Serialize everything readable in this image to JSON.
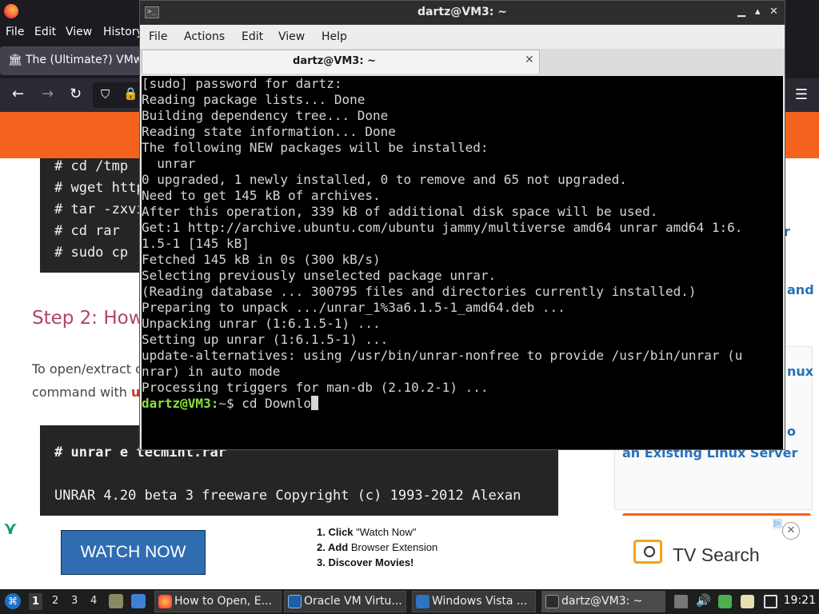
{
  "browser": {
    "menu": [
      "File",
      "Edit",
      "View",
      "History"
    ],
    "tab_title": "The (Ultimate?) VMwa",
    "code_lines": [
      "# cd /tmp",
      "# wget http",
      "# tar -zxvi",
      "# cd rar",
      "# sudo cp"
    ],
    "step_heading": "Step 2: How",
    "para_line1": "To open/extract o",
    "para_line2": "command with ",
    "para_line2_bold": "u",
    "code2_cmd": "# unrar e tecmint.rar",
    "code2_line": "UNRAR 4.20 beta 3 freeware      Copyright (c) 1993-2012 Alexan",
    "sidebar_fragments": [
      "r",
      "and",
      "nux",
      "o"
    ],
    "sidebar_link": "an Existing Linux Server",
    "ad": {
      "button": "WATCH NOW",
      "steps": [
        {
          "num": "1. Click",
          "text": " \"Watch Now\""
        },
        {
          "num": "2. Add",
          "text": " Browser Extension"
        },
        {
          "num": "3. Discover Movies!",
          "text": ""
        }
      ],
      "brand": "TV Search",
      "close": "✕"
    }
  },
  "terminal": {
    "window_title": "dartz@VM3: ~",
    "menu": [
      "File",
      "Actions",
      "Edit",
      "View",
      "Help"
    ],
    "tab_label": "dartz@VM3: ~",
    "tab_close": "✕",
    "window_buttons": [
      "▁",
      "▴",
      "✕"
    ],
    "lines": [
      "[sudo] password for dartz:",
      "Reading package lists... Done",
      "Building dependency tree... Done",
      "Reading state information... Done",
      "The following NEW packages will be installed:",
      "  unrar",
      "0 upgraded, 1 newly installed, 0 to remove and 65 not upgraded.",
      "Need to get 145 kB of archives.",
      "After this operation, 339 kB of additional disk space will be used.",
      "Get:1 http://archive.ubuntu.com/ubuntu jammy/multiverse amd64 unrar amd64 1:6.",
      "1.5-1 [145 kB]",
      "Fetched 145 kB in 0s (300 kB/s)",
      "Selecting previously unselected package unrar.",
      "(Reading database ... 300795 files and directories currently installed.)",
      "Preparing to unpack .../unrar_1%3a6.1.5-1_amd64.deb ...",
      "Unpacking unrar (1:6.1.5-1) ...",
      "Setting up unrar (1:6.1.5-1) ...",
      "update-alternatives: using /usr/bin/unrar-nonfree to provide /usr/bin/unrar (u",
      "nrar) in auto mode",
      "Processing triggers for man-db (2.10.2-1) ..."
    ],
    "prompt_user": "dartz@VM3",
    "prompt_sep": ":",
    "prompt_path": "~",
    "prompt_symbol": "$ ",
    "current_input": "cd Downlo"
  },
  "taskbar": {
    "workspaces": [
      "1",
      "2",
      "3",
      "4"
    ],
    "active_workspace": "1",
    "tasks": [
      {
        "label": "How to Open, E...",
        "icon": "firefox-icon"
      },
      {
        "label": "Oracle VM Virtu...",
        "icon": "virtualbox-icon"
      },
      {
        "label": "Windows Vista ...",
        "icon": "windows-vm-icon"
      },
      {
        "label": "dartz@VM3: ~",
        "icon": "terminal-icon"
      }
    ],
    "clock": "19:21"
  },
  "colors": {
    "site_orange": "#f4631d",
    "heading_pink": "#b0436b",
    "link_blue": "#2a6fb8",
    "prompt_green": "#8ae234",
    "prompt_blue": "#729fcf"
  }
}
